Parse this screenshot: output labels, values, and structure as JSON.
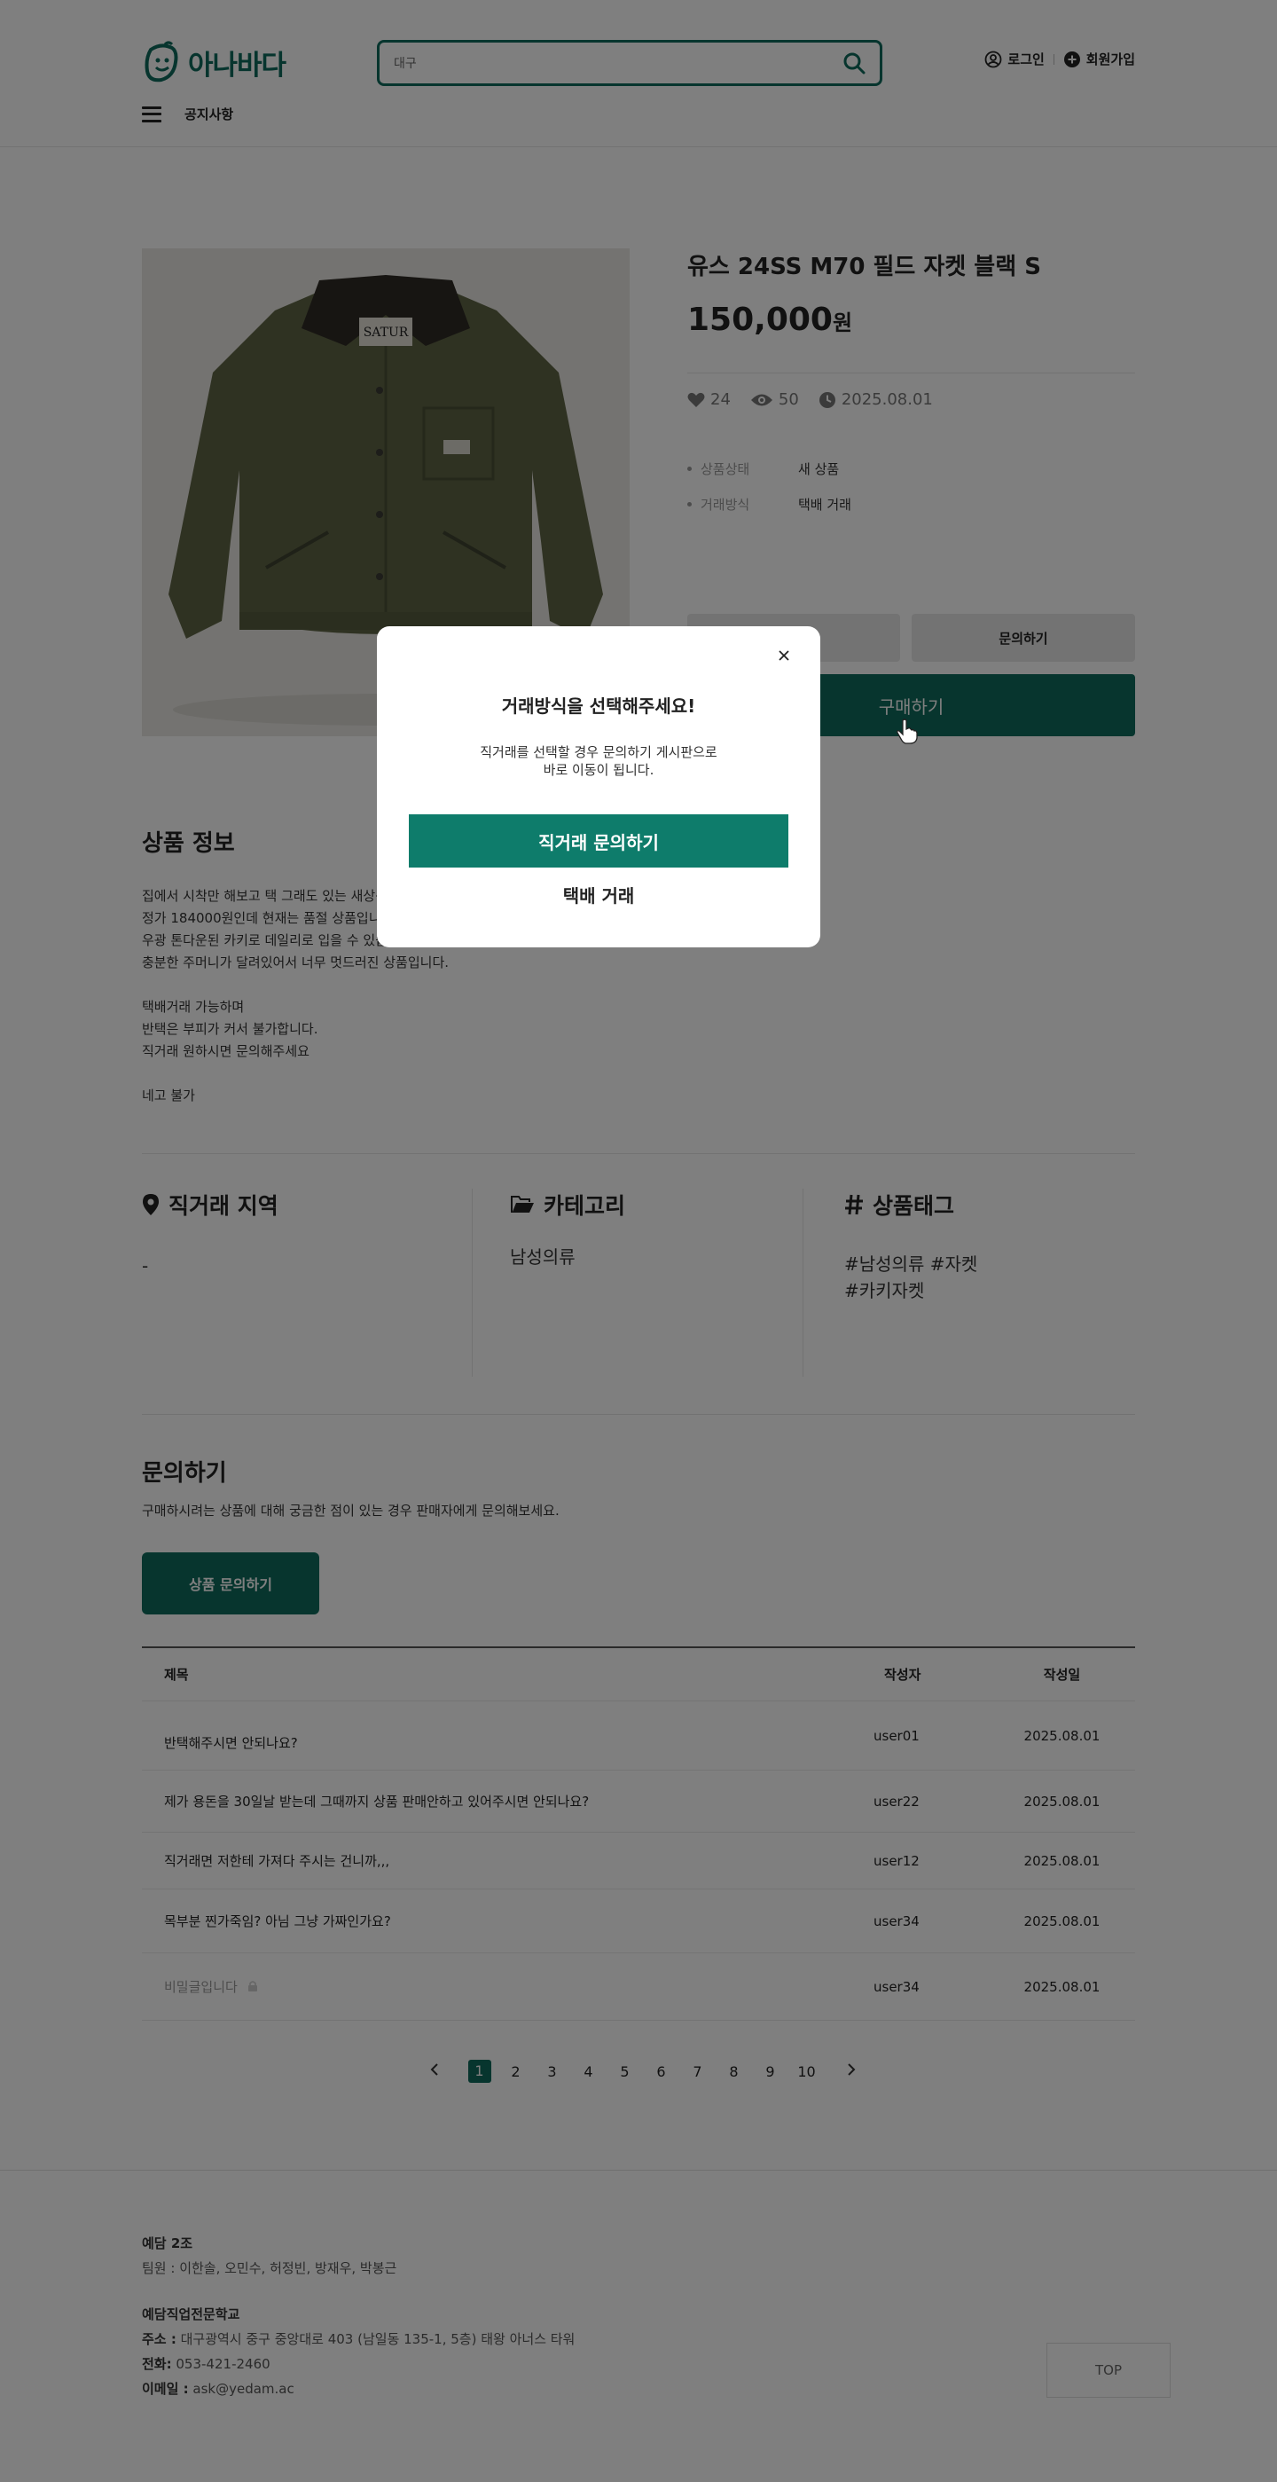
{
  "header": {
    "logo_text": "아나바다",
    "search_value": "대구",
    "login": "로그인",
    "signup": "회원가입",
    "notice": "공지사항"
  },
  "product": {
    "title": "유스 24SS M70 필드 자켓 블랙 S",
    "price": "150,000",
    "price_unit": "원",
    "likes": "24",
    "views": "50",
    "date": "2025.08.01",
    "info": [
      {
        "key": "상품상태",
        "value": "새 상품"
      },
      {
        "key": "거래방식",
        "value": "택배 거래"
      }
    ],
    "inquiry_button": "문의하기",
    "buy_button": "구매하기"
  },
  "description": {
    "title": "상품 정보",
    "lines": [
      "집에서 시착만 해보고 택 그래도 있는 새상품입니다.",
      "정가 184000원인데 현재는 품절 상품입니다.",
      "우광 톤다운된 카키로 데일리로 입을 수 있습니다.",
      "충분한 주머니가 달려있어서 너무 멋드러진 상품입니다.",
      "",
      "택배거래 가능하며",
      "반택은 부피가 커서 불가합니다.",
      "직거래 원하시면 문의해주세요",
      "",
      "네고 불가"
    ]
  },
  "details": {
    "region_title": "직거래 지역",
    "region_value": "-",
    "category_title": "카테고리",
    "category_value": "남성의류",
    "tag_title": "상품태그",
    "tags_line1": "#남성의류 #자켓",
    "tags_line2": "#카키자켓"
  },
  "inquiry": {
    "title": "문의하기",
    "subtitle": "구매하시려는 상품에 대해 궁금한 점이 있는 경우 판매자에게 문의해보세요.",
    "button": "상품 문의하기",
    "headers": {
      "title": "제목",
      "author": "작성자",
      "date": "작성일"
    },
    "rows": [
      {
        "title": "반택해주시면 안되나요?",
        "author": "user01",
        "date": "2025.08.01"
      },
      {
        "title": "제가 용돈을 30일날 받는데 그때까지 상품 판매안하고 있어주시면 안되나요?",
        "author": "user22",
        "date": "2025.08.01"
      },
      {
        "title": "직거래면 저한테 가져다 주시는 건니까,,,",
        "author": "user12",
        "date": "2025.08.01"
      },
      {
        "title": "목부분 찐가죽임? 아님 그냥 가짜인가요?",
        "author": "user34",
        "date": "2025.08.01"
      },
      {
        "title": "비밀글입니다",
        "author": "user34",
        "date": "2025.08.01"
      }
    ],
    "pages": [
      "1",
      "2",
      "3",
      "4",
      "5",
      "6",
      "7",
      "8",
      "9",
      "10"
    ],
    "current_page": "1"
  },
  "footer": {
    "team": "예담 2조",
    "members": "팀원 : 이한솔, 오민수, 허정빈, 방재우, 박봉근",
    "school": "예담직업전문학교",
    "address_label": "주소 :",
    "address": "대구광역시 중구 중앙대로 403 (남일동 135-1, 5층) 태왕 아너스 타워",
    "phone_label": "전화:",
    "phone": "053-421-2460",
    "email_label": "이메일 :",
    "email": "ask@yedam.ac",
    "top": "TOP"
  },
  "modal": {
    "title": "거래방식을 선택해주세요!",
    "desc_line1": "직거래를 선택할 경우 문의하기 게시판으로",
    "desc_line2": "바로 이동이 됩니다.",
    "primary": "직거래 문의하기",
    "secondary": "택배 거래"
  },
  "colors": {
    "brand": "#0e6b5c",
    "overlay": "rgba(0,0,0,0.5)"
  },
  "icons": [
    "logo-mark-icon",
    "search-icon",
    "user-icon",
    "plus-circle-icon",
    "hamburger-icon",
    "heart-icon",
    "eye-icon",
    "clock-icon",
    "map-pin-icon",
    "folder-icon",
    "hash-icon",
    "chevron-left-icon",
    "chevron-right-icon",
    "close-icon",
    "cursor-icon"
  ]
}
